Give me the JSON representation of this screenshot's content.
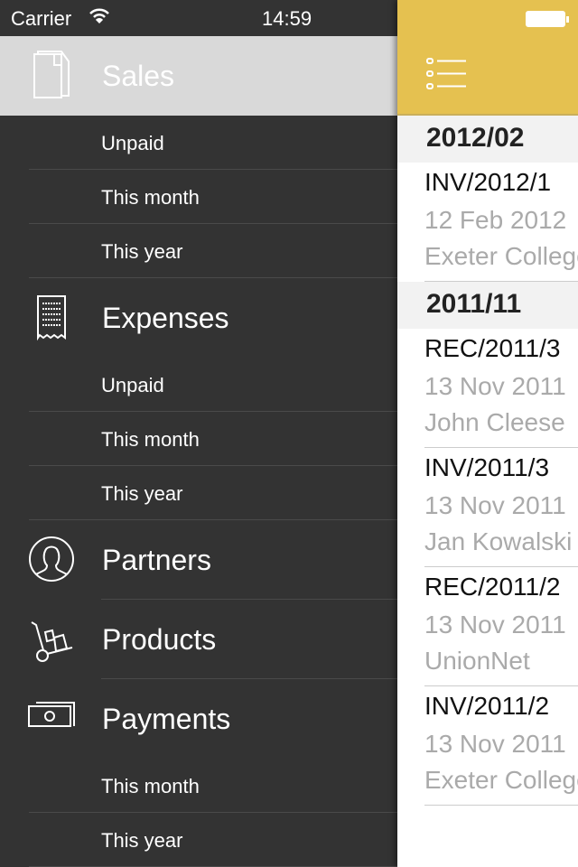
{
  "status": {
    "carrier": "Carrier",
    "time": "14:59"
  },
  "colors": {
    "accent": "#e5c150",
    "sidebar": "#333333",
    "active": "#d9d9d9"
  },
  "menu": [
    {
      "label": "Sales",
      "icon": "document-icon",
      "active": true,
      "subs": [
        "Unpaid",
        "This month",
        "This year"
      ]
    },
    {
      "label": "Expenses",
      "icon": "receipt-icon",
      "subs": [
        "Unpaid",
        "This month",
        "This year"
      ]
    },
    {
      "label": "Partners",
      "icon": "person-icon",
      "subs": []
    },
    {
      "label": "Products",
      "icon": "hand-truck-icon",
      "subs": []
    },
    {
      "label": "Payments",
      "icon": "banknote-icon",
      "subs": [
        "This month",
        "This year"
      ]
    }
  ],
  "list": [
    {
      "section": "2012/02",
      "items": [
        {
          "number": "INV/2012/1",
          "date": "12 Feb 2012",
          "partner": "Exeter College"
        }
      ]
    },
    {
      "section": "2011/11",
      "items": [
        {
          "number": "REC/2011/3",
          "date": "13 Nov 2011",
          "partner": "John Cleese"
        },
        {
          "number": "INV/2011/3",
          "date": "13 Nov 2011",
          "partner": "Jan Kowalski"
        },
        {
          "number": "REC/2011/2",
          "date": "13 Nov 2011",
          "partner": "UnionNet"
        },
        {
          "number": "INV/2011/2",
          "date": "13 Nov 2011",
          "partner": "Exeter College"
        }
      ]
    }
  ]
}
